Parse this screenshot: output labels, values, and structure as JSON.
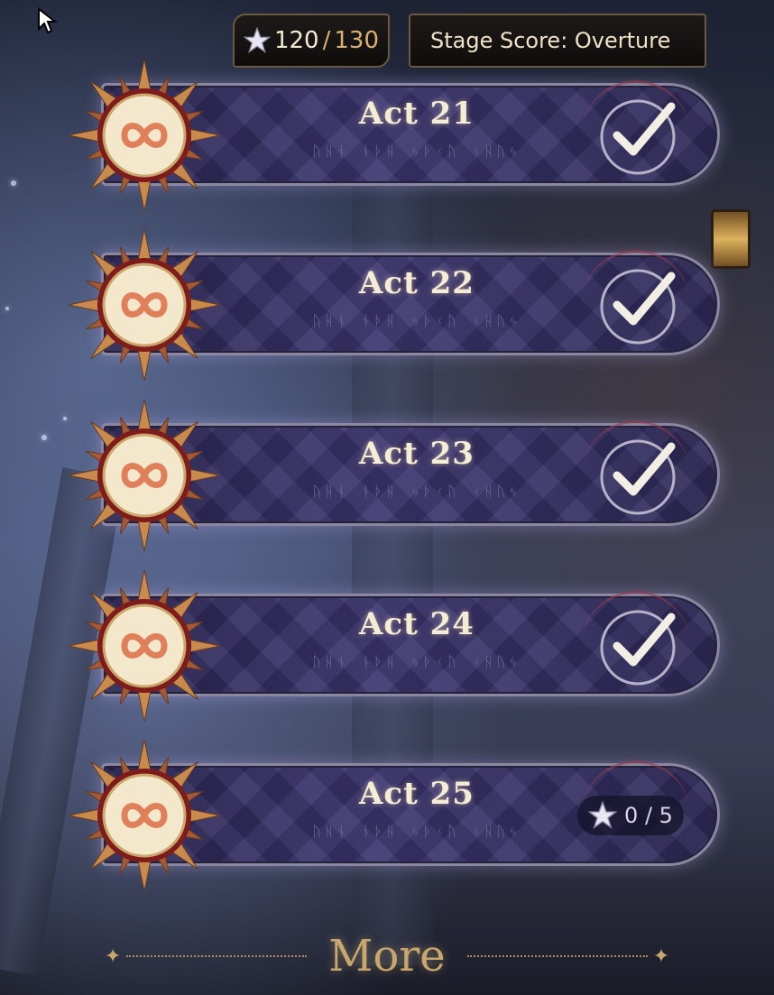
{
  "header": {
    "stars_current": "120",
    "stars_separator": "/",
    "stars_max": "130",
    "stage_score_label": "Stage Score: Overture"
  },
  "acts": [
    {
      "title": "Act 21",
      "runes": "ᚢᚺᚾ ᚾᚦᚺ ᛃᚦᚲᚢ ᚲᚺᚢᛃ",
      "status": "cleared"
    },
    {
      "title": "Act 22",
      "runes": "ᚢᚺᚾ ᚾᚦᚺ ᛃᚦᚲᚢ ᚲᚺᚢᛃ",
      "status": "cleared"
    },
    {
      "title": "Act 23",
      "runes": "ᚢᚺᚾ ᚾᚦᚺ ᛃᚦᚲᚢ ᚲᚺᚢᛃ",
      "status": "cleared"
    },
    {
      "title": "Act 24",
      "runes": "ᚢᚺᚾ ᚾᚦᚺ ᛃᚦᚲᚢ ᚲᚺᚢᛃ",
      "status": "cleared"
    },
    {
      "title": "Act 25",
      "runes": "ᚢᚺᚾ ᚾᚦᚺ ᛃᚦᚲᚢ ᚲᚺᚢᛃ",
      "status": "in-progress",
      "stars": "0 / 5"
    }
  ],
  "more_label": "More",
  "icons": {
    "cursor": "cursor-icon",
    "star": "star-icon",
    "check": "check-icon",
    "sun": "sun-emblem-icon",
    "sparkle": "sparkle-icon"
  },
  "colors": {
    "gold": "#c7a76b",
    "panel": "#3c3670",
    "text": "#f5ecd6"
  }
}
